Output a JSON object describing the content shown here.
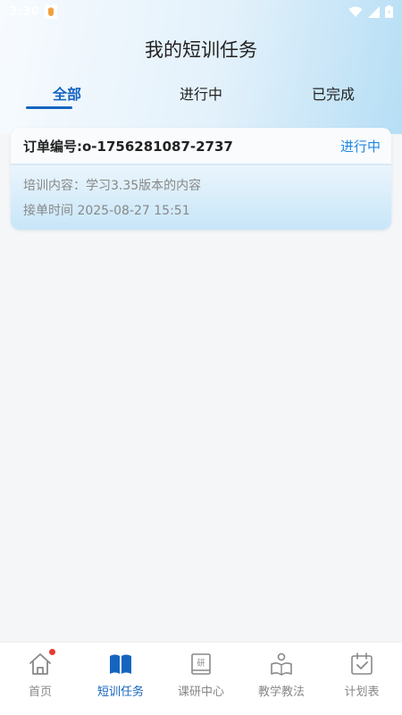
{
  "status_bar": {
    "time": "3:30"
  },
  "header": {
    "title": "我的短训任务"
  },
  "tabs": [
    {
      "label": "全部",
      "active": true
    },
    {
      "label": "进行中",
      "active": false
    },
    {
      "label": "已完成",
      "active": false
    }
  ],
  "orders": [
    {
      "order_label": "订单编号:o-1756281087-2737",
      "status": "进行中",
      "content": "培训内容：学习3.35版本的内容",
      "time": "接单时间 2025-08-27 15:51"
    }
  ],
  "bottom_nav": [
    {
      "label": "首页",
      "icon": "home-icon",
      "badge": true,
      "active": false
    },
    {
      "label": "短训任务",
      "icon": "book-icon",
      "badge": false,
      "active": true
    },
    {
      "label": "课研中心",
      "icon": "research-book-icon",
      "badge": false,
      "active": false
    },
    {
      "label": "教学教法",
      "icon": "teacher-icon",
      "badge": false,
      "active": false
    },
    {
      "label": "计划表",
      "icon": "calendar-check-icon",
      "badge": false,
      "active": false
    }
  ],
  "colors": {
    "accent": "#1565c0",
    "status_link": "#1e88e5",
    "badge": "#e53935"
  }
}
